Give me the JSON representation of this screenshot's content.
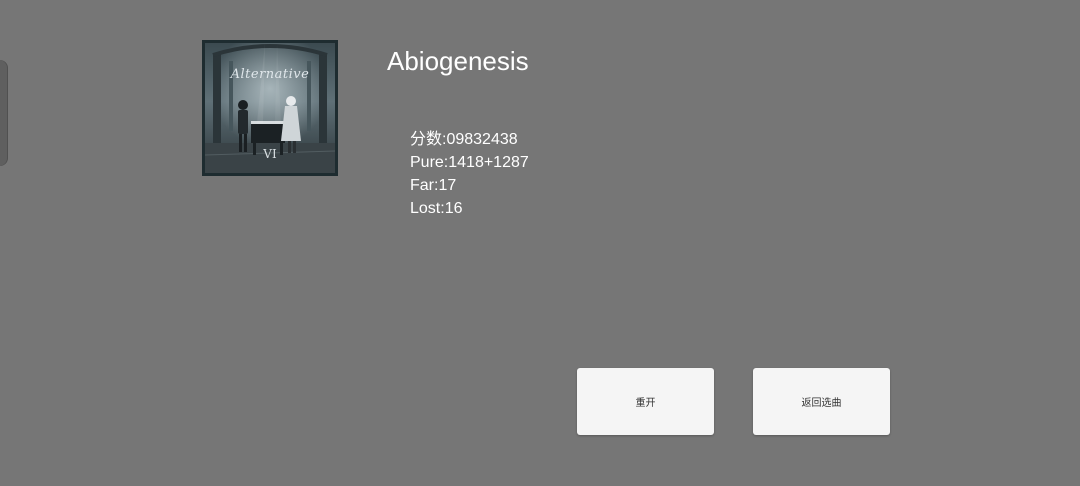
{
  "song": {
    "title": "Abiogenesis",
    "cover": {
      "title": "Alternative",
      "mark": "VI"
    }
  },
  "stats": {
    "score": "分数:09832438",
    "pure": "Pure:1418+1287",
    "far": "Far:17",
    "lost": "Lost:16"
  },
  "buttons": {
    "restart": "重开",
    "back_to_select": "返回选曲"
  }
}
